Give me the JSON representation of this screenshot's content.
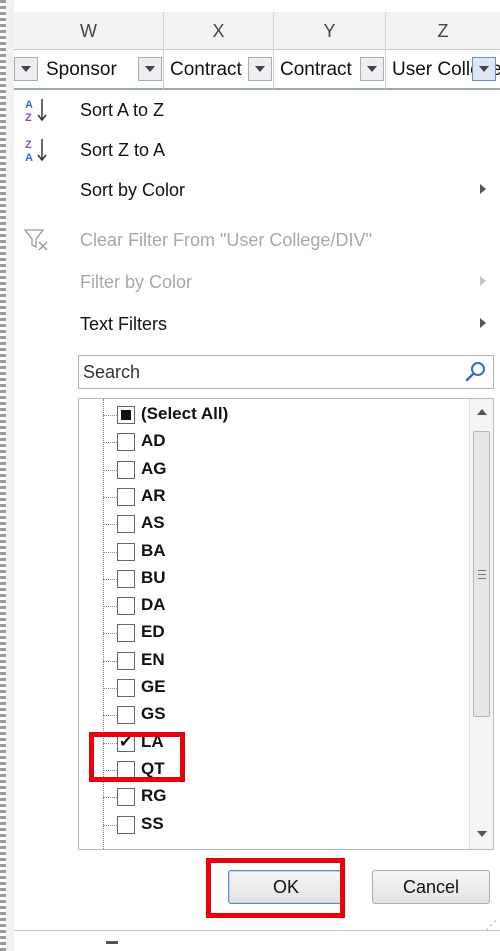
{
  "column_headers": [
    "W",
    "X",
    "Y",
    "Z"
  ],
  "filter_row": {
    "cells": [
      "Sponsor",
      "Contract",
      "Contract",
      "User College/DIV"
    ]
  },
  "menu": {
    "sort_a_to_z": "Sort A to Z",
    "sort_z_to_a": "Sort Z to A",
    "sort_by_color": "Sort by Color",
    "clear_filter": "Clear Filter From \"User College/DIV\"",
    "filter_by_color": "Filter by Color",
    "text_filters": "Text Filters"
  },
  "search": {
    "placeholder": "Search"
  },
  "list": {
    "items": [
      {
        "label": "(Select All)",
        "state": "partial"
      },
      {
        "label": "AD",
        "state": "unchecked"
      },
      {
        "label": "AG",
        "state": "unchecked"
      },
      {
        "label": "AR",
        "state": "unchecked"
      },
      {
        "label": "AS",
        "state": "unchecked"
      },
      {
        "label": "BA",
        "state": "unchecked"
      },
      {
        "label": "BU",
        "state": "unchecked"
      },
      {
        "label": "DA",
        "state": "unchecked"
      },
      {
        "label": "ED",
        "state": "unchecked"
      },
      {
        "label": "EN",
        "state": "unchecked"
      },
      {
        "label": "GE",
        "state": "unchecked"
      },
      {
        "label": "GS",
        "state": "unchecked"
      },
      {
        "label": "LA",
        "state": "checked"
      },
      {
        "label": "QT",
        "state": "unchecked"
      },
      {
        "label": "RG",
        "state": "unchecked"
      },
      {
        "label": "SS",
        "state": "unchecked"
      }
    ]
  },
  "buttons": {
    "ok": "OK",
    "cancel": "Cancel"
  },
  "colors": {
    "highlight_box": "#e8000b",
    "sort_icon_blue": "#2f6fc7",
    "sort_icon_purple": "#8a4fb0"
  }
}
